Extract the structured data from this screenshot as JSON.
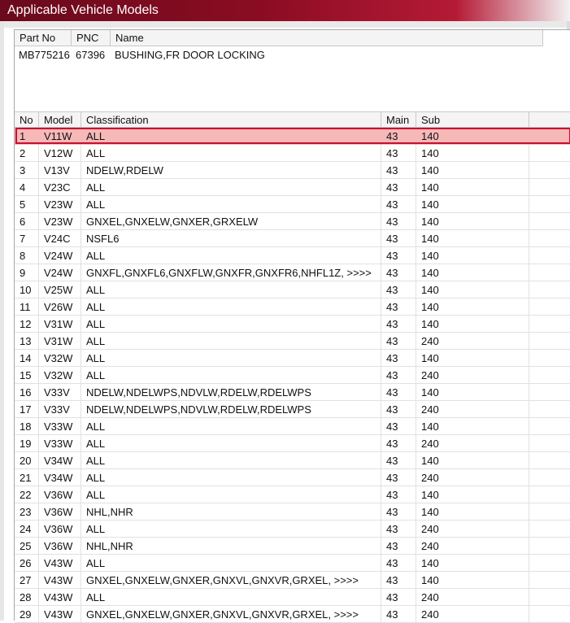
{
  "window": {
    "title": "Applicable Vehicle Models"
  },
  "part": {
    "columns": [
      "Part No",
      "PNC",
      "Name"
    ],
    "row": {
      "part_no": "MB775216",
      "pnc": "67396",
      "name": "BUSHING,FR DOOR LOCKING"
    }
  },
  "grid": {
    "columns": [
      "No",
      "Model",
      "Classification",
      "Main",
      "Sub"
    ],
    "selected_row": 0,
    "accent_color": "#c8102e",
    "rows": [
      {
        "no": "1",
        "model": "V11W",
        "classification": "ALL",
        "main": "43",
        "sub": "140"
      },
      {
        "no": "2",
        "model": "V12W",
        "classification": "ALL",
        "main": "43",
        "sub": "140"
      },
      {
        "no": "3",
        "model": "V13V",
        "classification": "NDELW,RDELW",
        "main": "43",
        "sub": "140"
      },
      {
        "no": "4",
        "model": "V23C",
        "classification": "ALL",
        "main": "43",
        "sub": "140"
      },
      {
        "no": "5",
        "model": "V23W",
        "classification": "ALL",
        "main": "43",
        "sub": "140"
      },
      {
        "no": "6",
        "model": "V23W",
        "classification": "GNXEL,GNXELW,GNXER,GRXELW",
        "main": "43",
        "sub": "140"
      },
      {
        "no": "7",
        "model": "V24C",
        "classification": "NSFL6",
        "main": "43",
        "sub": "140"
      },
      {
        "no": "8",
        "model": "V24W",
        "classification": "ALL",
        "main": "43",
        "sub": "140"
      },
      {
        "no": "9",
        "model": "V24W",
        "classification": "GNXFL,GNXFL6,GNXFLW,GNXFR,GNXFR6,NHFL1Z,  >>>>",
        "main": "43",
        "sub": "140"
      },
      {
        "no": "10",
        "model": "V25W",
        "classification": "ALL",
        "main": "43",
        "sub": "140"
      },
      {
        "no": "11",
        "model": "V26W",
        "classification": "ALL",
        "main": "43",
        "sub": "140"
      },
      {
        "no": "12",
        "model": "V31W",
        "classification": "ALL",
        "main": "43",
        "sub": "140"
      },
      {
        "no": "13",
        "model": "V31W",
        "classification": "ALL",
        "main": "43",
        "sub": "240"
      },
      {
        "no": "14",
        "model": "V32W",
        "classification": "ALL",
        "main": "43",
        "sub": "140"
      },
      {
        "no": "15",
        "model": "V32W",
        "classification": "ALL",
        "main": "43",
        "sub": "240"
      },
      {
        "no": "16",
        "model": "V33V",
        "classification": "NDELW,NDELWPS,NDVLW,RDELW,RDELWPS",
        "main": "43",
        "sub": "140"
      },
      {
        "no": "17",
        "model": "V33V",
        "classification": "NDELW,NDELWPS,NDVLW,RDELW,RDELWPS",
        "main": "43",
        "sub": "240"
      },
      {
        "no": "18",
        "model": "V33W",
        "classification": "ALL",
        "main": "43",
        "sub": "140"
      },
      {
        "no": "19",
        "model": "V33W",
        "classification": "ALL",
        "main": "43",
        "sub": "240"
      },
      {
        "no": "20",
        "model": "V34W",
        "classification": "ALL",
        "main": "43",
        "sub": "140"
      },
      {
        "no": "21",
        "model": "V34W",
        "classification": "ALL",
        "main": "43",
        "sub": "240"
      },
      {
        "no": "22",
        "model": "V36W",
        "classification": "ALL",
        "main": "43",
        "sub": "140"
      },
      {
        "no": "23",
        "model": "V36W",
        "classification": "NHL,NHR",
        "main": "43",
        "sub": "140"
      },
      {
        "no": "24",
        "model": "V36W",
        "classification": "ALL",
        "main": "43",
        "sub": "240"
      },
      {
        "no": "25",
        "model": "V36W",
        "classification": "NHL,NHR",
        "main": "43",
        "sub": "240"
      },
      {
        "no": "26",
        "model": "V43W",
        "classification": "ALL",
        "main": "43",
        "sub": "140"
      },
      {
        "no": "27",
        "model": "V43W",
        "classification": "GNXEL,GNXELW,GNXER,GNXVL,GNXVR,GRXEL,  >>>>",
        "main": "43",
        "sub": "140"
      },
      {
        "no": "28",
        "model": "V43W",
        "classification": "ALL",
        "main": "43",
        "sub": "240"
      },
      {
        "no": "29",
        "model": "V43W",
        "classification": "GNXEL,GNXELW,GNXER,GNXVL,GNXVR,GRXEL,  >>>>",
        "main": "43",
        "sub": "240"
      }
    ]
  }
}
